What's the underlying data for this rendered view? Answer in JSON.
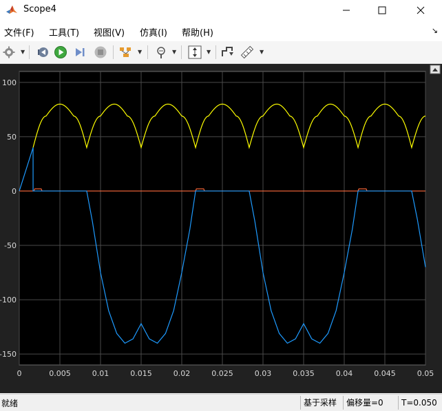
{
  "window": {
    "title": "Scope4"
  },
  "menu": {
    "items": [
      {
        "label": "文件(F)"
      },
      {
        "label": "工具(T)"
      },
      {
        "label": "视图(V)"
      },
      {
        "label": "仿真(I)"
      },
      {
        "label": "帮助(H)"
      }
    ]
  },
  "toolbar": {
    "buttons": [
      "settings-icon",
      "step-back-icon",
      "run-icon",
      "step-forward-icon",
      "stop-icon",
      "signal-selector-icon",
      "zoom-icon",
      "scale-axes-icon",
      "cursor-measure-icon",
      "measure-ruler-icon"
    ]
  },
  "status": {
    "left": "就绪",
    "mode": "基于采样",
    "offset": "偏移量=0",
    "time": "T=0.050"
  },
  "chart_data": {
    "type": "line",
    "xlim": [
      0,
      0.05
    ],
    "ylim": [
      -160,
      110
    ],
    "xticks": [
      "0",
      "0.005",
      "0.01",
      "0.015",
      "0.02",
      "0.025",
      "0.03",
      "0.035",
      "0.04",
      "0.045",
      "0.05"
    ],
    "yticks": [
      "100",
      "50",
      "0",
      "-50",
      "-100",
      "-150"
    ],
    "grid": true,
    "legend": "none",
    "background": "#000000",
    "series": [
      {
        "color": "#ffff00",
        "x": [
          0.0017,
          0.0033,
          0.005,
          0.0067,
          0.0083,
          0.01,
          0.0117,
          0.0133,
          0.015,
          0.0167,
          0.0183,
          0.02,
          0.0217,
          0.0233,
          0.025,
          0.0267,
          0.0283,
          0.03,
          0.0317,
          0.0333,
          0.035,
          0.0367,
          0.0383,
          0.04,
          0.0417,
          0.0433,
          0.045,
          0.0467,
          0.0483,
          0.05
        ],
        "y": [
          40,
          69,
          80,
          69,
          40,
          69,
          80,
          69,
          40,
          69,
          80,
          69,
          40,
          69,
          80,
          69,
          40,
          69,
          80,
          69,
          40,
          69,
          80,
          69,
          40,
          69,
          80,
          69,
          40,
          69
        ]
      },
      {
        "color": "#ff6b3d",
        "x": [
          0,
          0.0018,
          0.0019,
          0.0027,
          0.0028,
          0.0217,
          0.0218,
          0.0227,
          0.0228,
          0.0417,
          0.0418,
          0.0427,
          0.0428,
          0.05
        ],
        "y": [
          0,
          0,
          2,
          2,
          0,
          0,
          2,
          2,
          0,
          0,
          2,
          2,
          0,
          0
        ]
      },
      {
        "color": "#1e9bff",
        "x": [
          0,
          0.0017,
          0.0017,
          0.0028,
          0.0083,
          0.009,
          0.01,
          0.011,
          0.012,
          0.013,
          0.014,
          0.015,
          0.016,
          0.017,
          0.018,
          0.019,
          0.02,
          0.021,
          0.0217,
          0.0228,
          0.0283,
          0.029,
          0.03,
          0.031,
          0.032,
          0.033,
          0.034,
          0.035,
          0.036,
          0.037,
          0.038,
          0.039,
          0.04,
          0.041,
          0.0417,
          0.0428,
          0.0483,
          0.049,
          0.05
        ],
        "y": [
          0,
          40,
          0,
          0,
          0,
          -28,
          -75,
          -110,
          -131,
          -140,
          -136,
          -122,
          -136,
          -140,
          -131,
          -110,
          -75,
          -35,
          0,
          0,
          0,
          -28,
          -75,
          -110,
          -131,
          -140,
          -136,
          -122,
          -136,
          -140,
          -131,
          -110,
          -75,
          -35,
          0,
          0,
          0,
          -26,
          -70
        ]
      }
    ]
  }
}
